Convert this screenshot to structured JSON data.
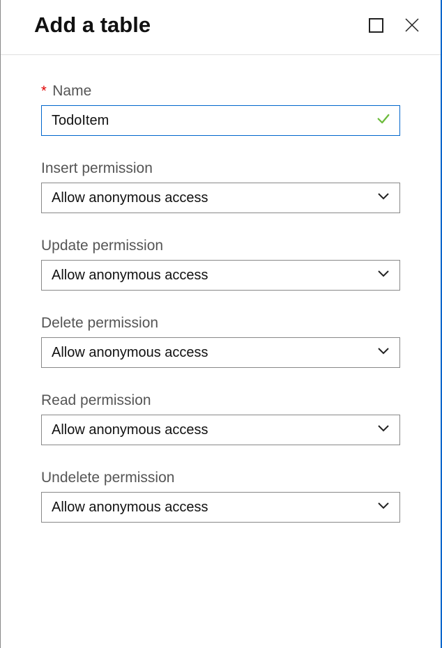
{
  "header": {
    "title": "Add a table"
  },
  "fields": {
    "name": {
      "label": "Name",
      "required": true,
      "value": "TodoItem",
      "valid": true
    },
    "insert": {
      "label": "Insert permission",
      "value": "Allow anonymous access"
    },
    "update": {
      "label": "Update permission",
      "value": "Allow anonymous access"
    },
    "delete": {
      "label": "Delete permission",
      "value": "Allow anonymous access"
    },
    "read": {
      "label": "Read permission",
      "value": "Allow anonymous access"
    },
    "undelete": {
      "label": "Undelete permission",
      "value": "Allow anonymous access"
    }
  }
}
